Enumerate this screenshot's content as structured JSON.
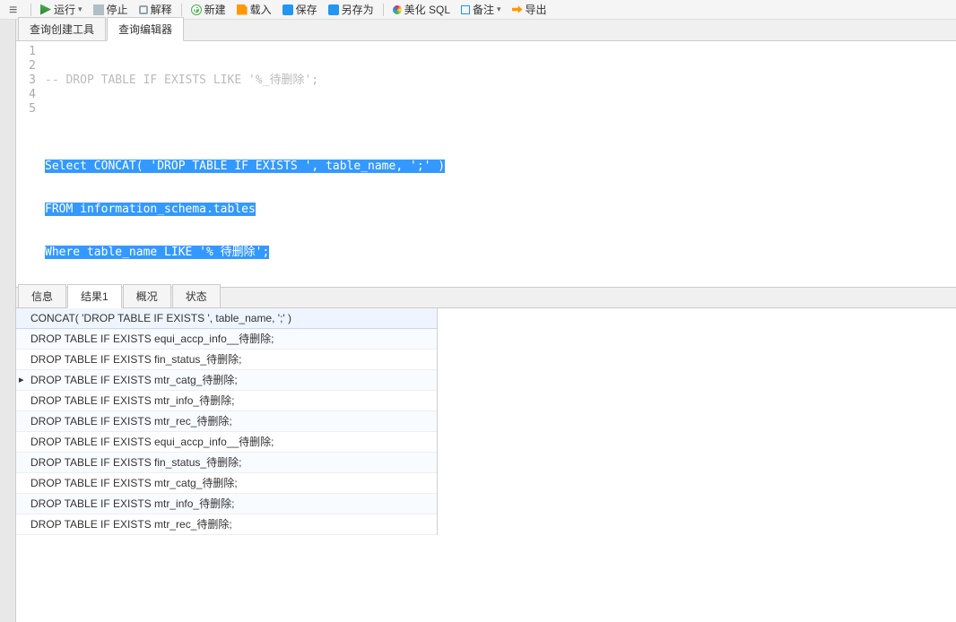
{
  "toolbar": {
    "run": "运行",
    "stop": "停止",
    "explain": "解释",
    "new": "新建",
    "load": "载入",
    "save": "保存",
    "saveas": "另存为",
    "beautify": "美化 SQL",
    "note": "备注",
    "export": "导出"
  },
  "editor_tabs": {
    "builder": "查询创建工具",
    "editor": "查询编辑器"
  },
  "code": {
    "l1": "-- DROP TABLE IF EXISTS LIKE '%_待删除';",
    "l2": "",
    "l3": "Select CONCAT( 'DROP TABLE IF EXISTS ', table_name, ';' )",
    "l4": "FROM information_schema.tables",
    "l5": "Where table_name LIKE '% 待删除';"
  },
  "line_numbers": [
    "1",
    "2",
    "3",
    "4",
    "5"
  ],
  "result_tabs": {
    "info": "信息",
    "result1": "结果1",
    "overview": "概况",
    "status": "状态"
  },
  "grid": {
    "header": "CONCAT( 'DROP TABLE IF EXISTS ', table_name, ';' )",
    "rows": [
      "DROP TABLE IF EXISTS equi_accp_info__待删除;",
      "DROP TABLE IF EXISTS fin_status_待删除;",
      "DROP TABLE IF EXISTS mtr_catg_待删除;",
      "DROP TABLE IF EXISTS mtr_info_待删除;",
      "DROP TABLE IF EXISTS mtr_rec_待删除;",
      "DROP TABLE IF EXISTS equi_accp_info__待删除;",
      "DROP TABLE IF EXISTS fin_status_待删除;",
      "DROP TABLE IF EXISTS mtr_catg_待删除;",
      "DROP TABLE IF EXISTS mtr_info_待删除;",
      "DROP TABLE IF EXISTS mtr_rec_待删除;"
    ],
    "current_row_index": 2
  }
}
